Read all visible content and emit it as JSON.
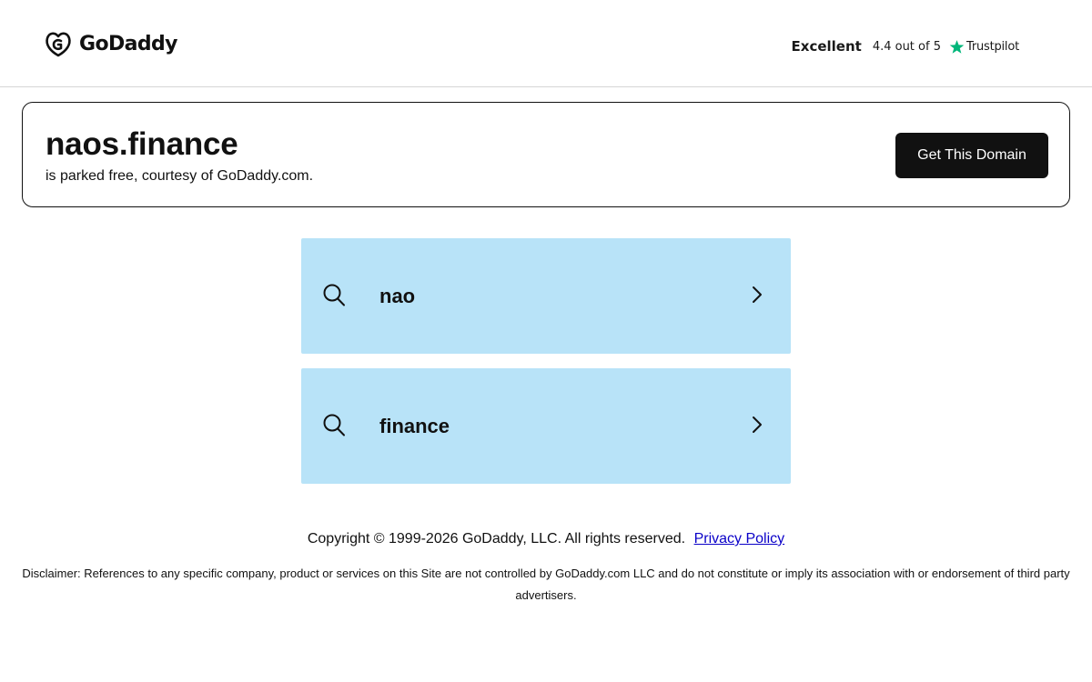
{
  "header": {
    "logo_text": "GoDaddy",
    "trustpilot": {
      "label": "Excellent",
      "rating": "4.4 out of 5",
      "brand": "Trustpilot",
      "star_color": "#00b67a"
    }
  },
  "domain_card": {
    "domain": "naos.finance",
    "subtitle": "is parked free, courtesy of GoDaddy.com.",
    "cta_label": "Get This Domain"
  },
  "search_suggestions": [
    {
      "label": "nao",
      "icon": "search-icon",
      "arrow": "chevron-right-icon"
    },
    {
      "label": "finance",
      "icon": "search-icon",
      "arrow": "chevron-right-icon"
    }
  ],
  "footer": {
    "copyright": "Copyright © 1999-2026 GoDaddy, LLC. All rights reserved.",
    "privacy_link": "Privacy Policy",
    "disclaimer": "Disclaimer: References to any specific company, product or services on this Site are not controlled by GoDaddy.com LLC and do not constitute or imply its association with or endorsement of third party advertisers."
  },
  "colors": {
    "suggestion_background": "#b8e3f8",
    "button_background": "#111111",
    "link": "#0a00c8"
  }
}
